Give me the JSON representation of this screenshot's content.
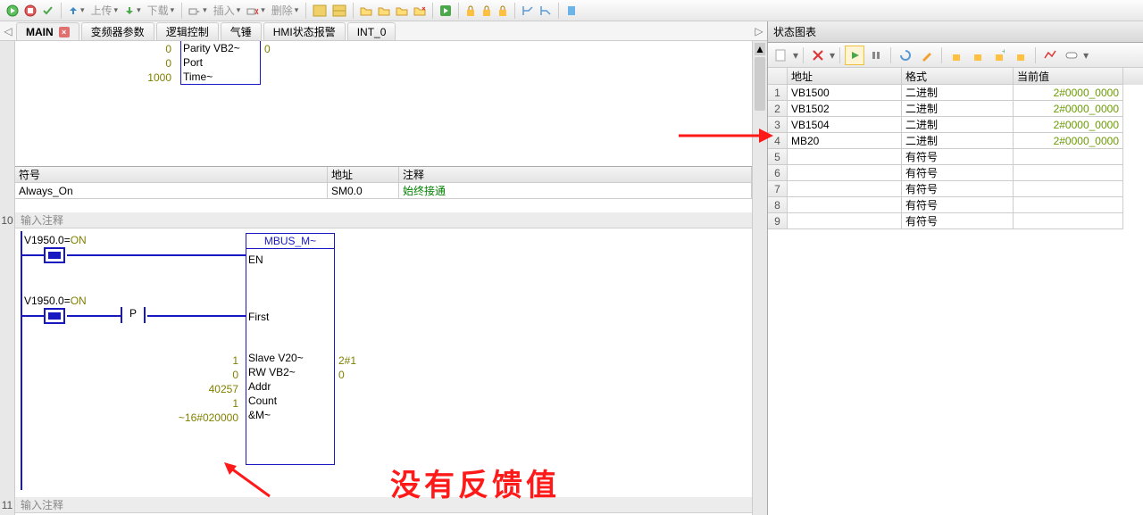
{
  "toolbar": {
    "upload": "上传",
    "download": "下载",
    "insert": "插入",
    "delete": "删除"
  },
  "tabs": [
    {
      "label": "MAIN",
      "active": true
    },
    {
      "label": "变频器参数"
    },
    {
      "label": "逻辑控制"
    },
    {
      "label": "气锤"
    },
    {
      "label": "HMI状态报警"
    },
    {
      "label": "INT_0"
    }
  ],
  "editor": {
    "top_block": {
      "pins": [
        {
          "left": "0",
          "label": "Parity  VB2~",
          "right": "0"
        },
        {
          "left": "0",
          "label": "Port"
        },
        {
          "left": "1000",
          "label": "Time~"
        }
      ]
    },
    "symbol_table": {
      "headers": {
        "c1": "符号",
        "c2": "地址",
        "c3": "注释"
      },
      "row": {
        "c1": "Always_On",
        "c2": "SM0.0",
        "c3": "始终接通"
      }
    },
    "network10": {
      "num": "10",
      "comment": "输入注释",
      "var1": "V1950.0=",
      "var1_state": "ON",
      "var2": "V1950.0=",
      "var2_state": "ON",
      "p": "P",
      "box_title": " MBUS_M~ ",
      "box_en": "EN",
      "box_first": "First",
      "box_pins": [
        {
          "l": "1",
          "lbl": "Slave  V20~",
          "r": "2#1"
        },
        {
          "l": "0",
          "lbl": "RW     VB2~",
          "r": "0"
        },
        {
          "l": "40257",
          "lbl": "Addr"
        },
        {
          "l": "1",
          "lbl": "Count"
        },
        {
          "l": "16#020000~",
          "lbl": "&M~"
        }
      ]
    },
    "network11": {
      "num": "11",
      "comment": "输入注释"
    }
  },
  "right": {
    "title": "状态图表",
    "headers": {
      "addr": "地址",
      "format": "格式",
      "value": "当前值"
    },
    "rows": [
      {
        "n": "1",
        "addr": "VB1500",
        "fmt": "二进制",
        "val": "2#0000_0000"
      },
      {
        "n": "2",
        "addr": "VB1502",
        "fmt": "二进制",
        "val": "2#0000_0000"
      },
      {
        "n": "3",
        "addr": "VB1504",
        "fmt": "二进制",
        "val": "2#0000_0000"
      },
      {
        "n": "4",
        "addr": "MB20",
        "fmt": "二进制",
        "val": "2#0000_0000"
      },
      {
        "n": "5",
        "addr": "",
        "fmt": "有符号",
        "val": ""
      },
      {
        "n": "6",
        "addr": "",
        "fmt": "有符号",
        "val": ""
      },
      {
        "n": "7",
        "addr": "",
        "fmt": "有符号",
        "val": ""
      },
      {
        "n": "8",
        "addr": "",
        "fmt": "有符号",
        "val": ""
      },
      {
        "n": "9",
        "addr": "",
        "fmt": "有符号",
        "val": ""
      }
    ]
  },
  "annotation": {
    "text": "没有反馈值"
  }
}
